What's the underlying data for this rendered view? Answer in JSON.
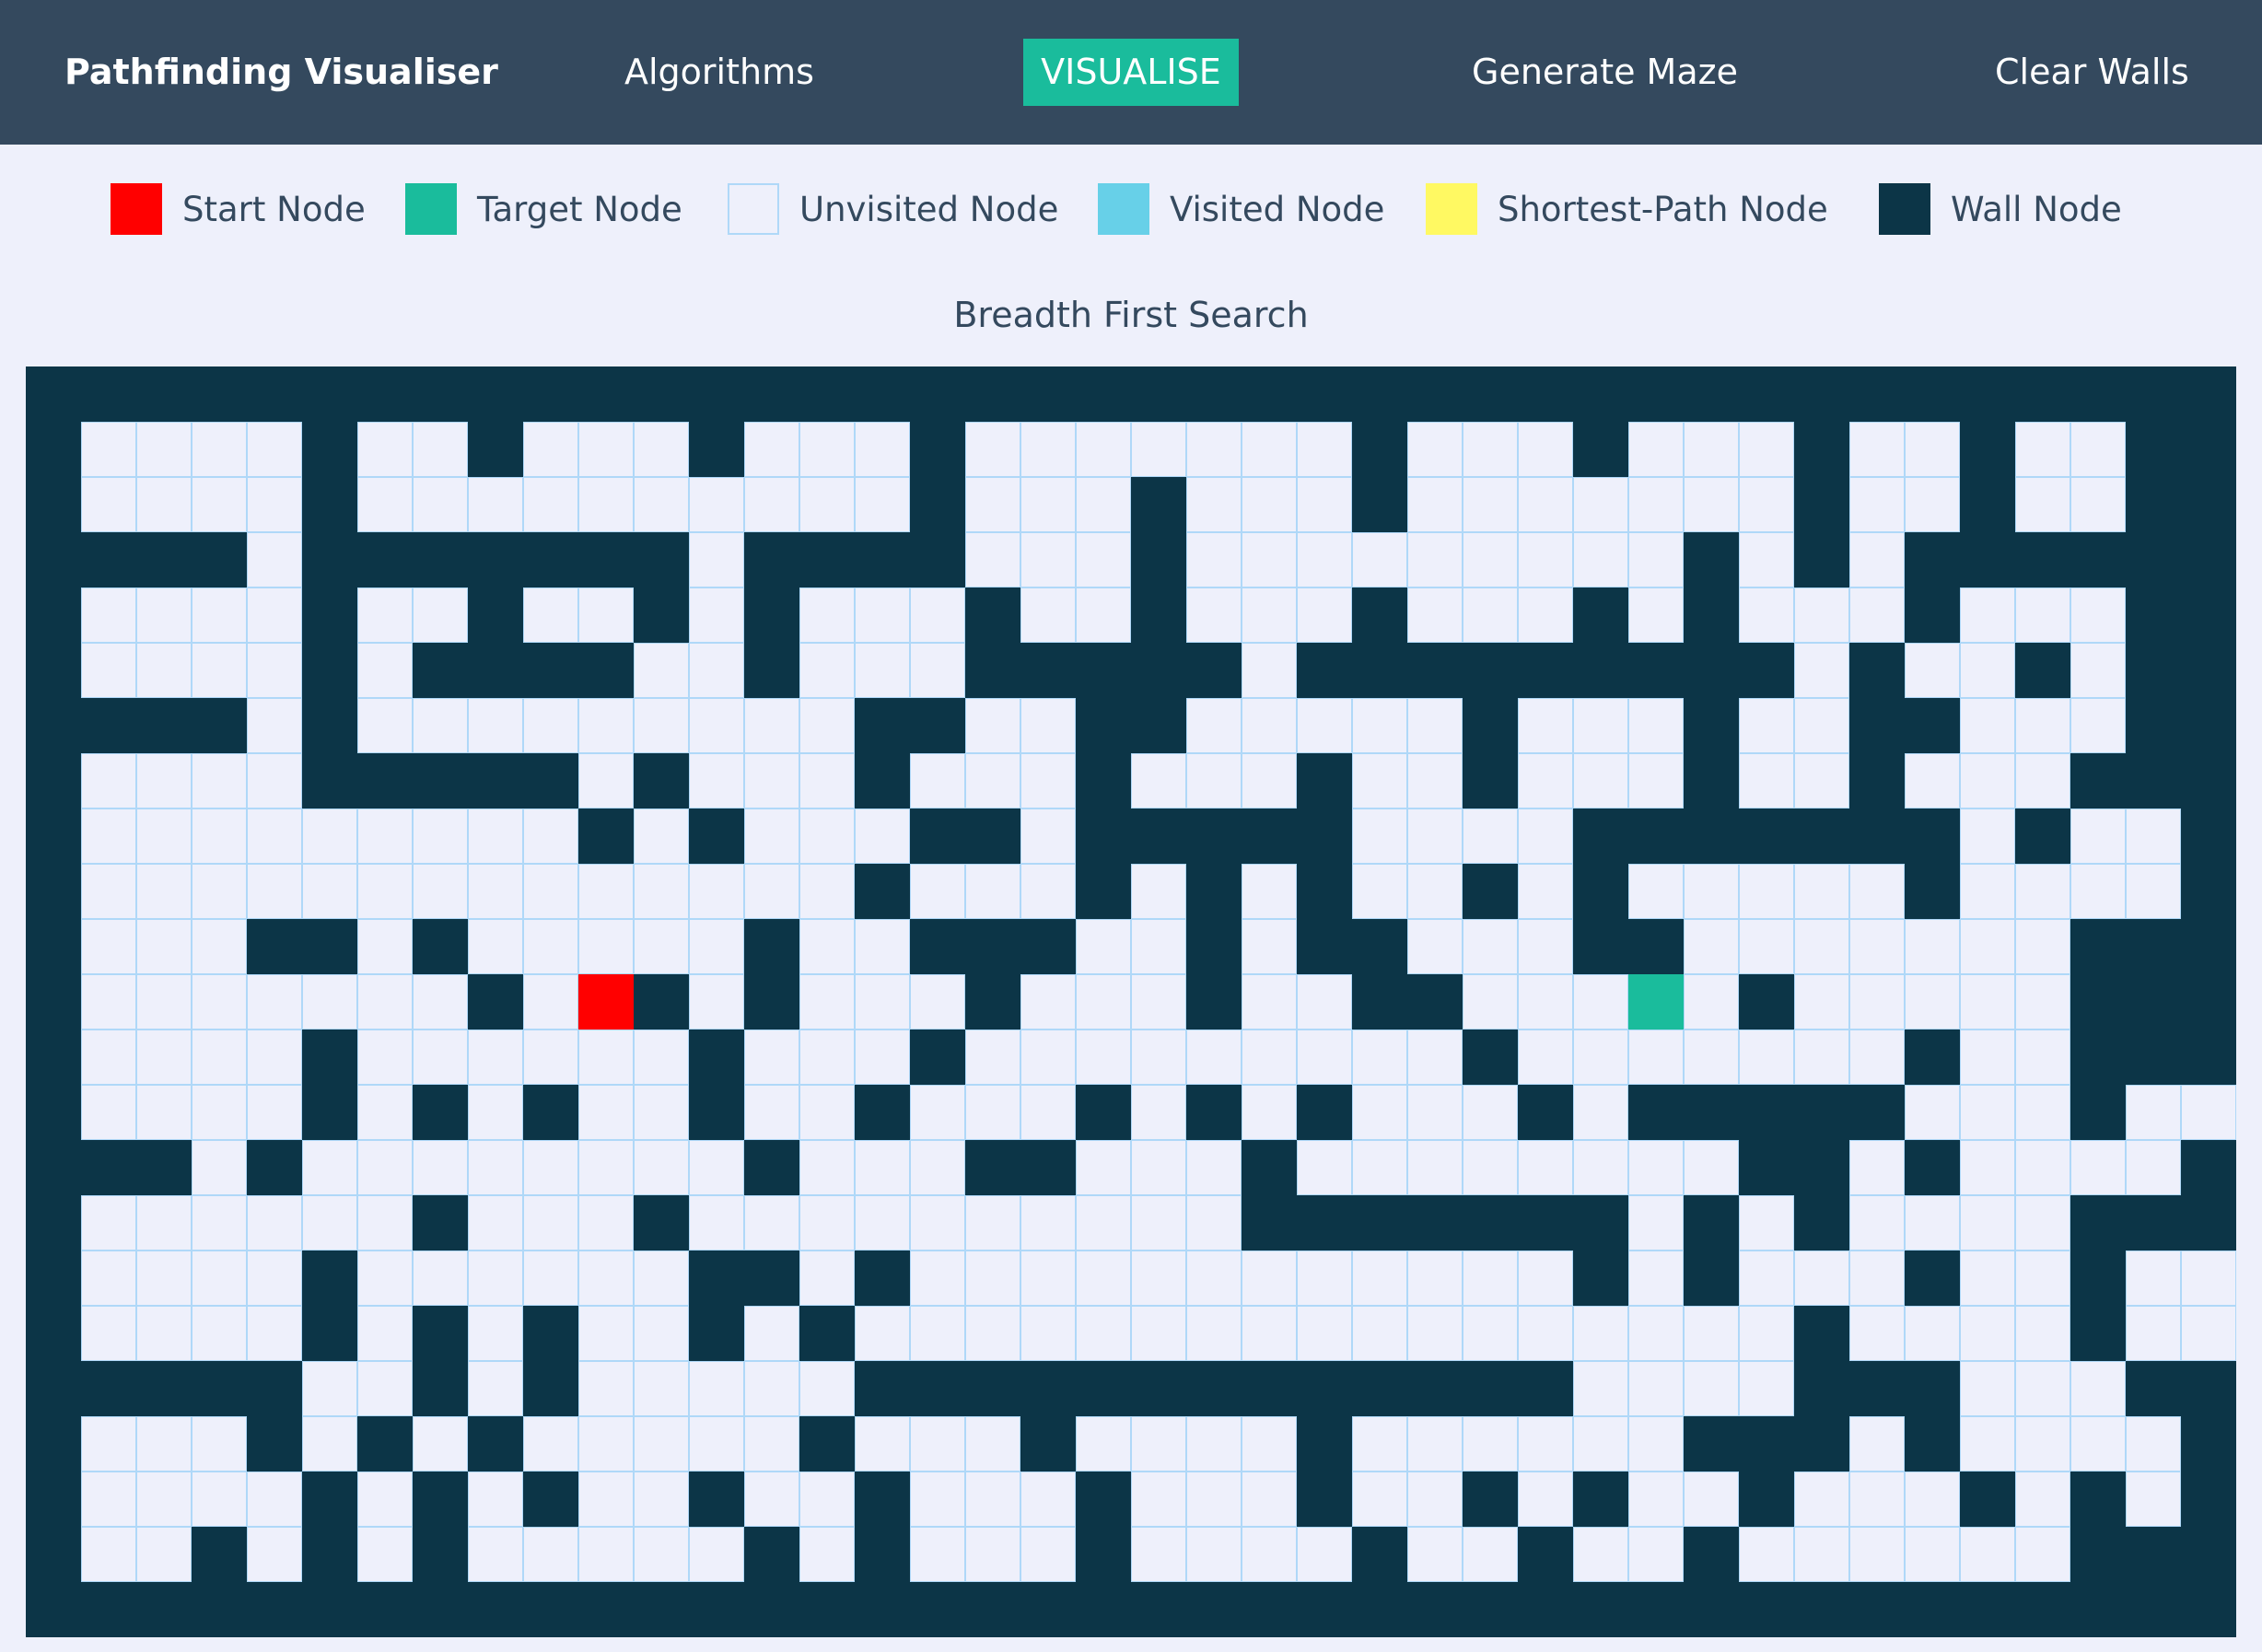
{
  "navbar": {
    "brand": "Pathfinding Visualiser",
    "algorithms_label": "Algorithms",
    "visualise_label": "VISUALISE",
    "generate_maze_label": "Generate Maze",
    "clear_walls_label": "Clear Walls"
  },
  "legend": [
    {
      "label": "Start Node",
      "color": "#ff0000"
    },
    {
      "label": "Target Node",
      "color": "#1abc9c"
    },
    {
      "label": "Unvisited Node",
      "color": "#eef0fb"
    },
    {
      "label": "Visited Node",
      "color": "#67d0e8"
    },
    {
      "label": "Shortest-Path Node",
      "color": "#fff962"
    },
    {
      "label": "Wall Node",
      "color": "#0c3547"
    }
  ],
  "algorithm_title": "Breadth First Search",
  "colors": {
    "navbar": "#34495e",
    "accent": "#1abc9c",
    "wall": "#0c3547",
    "unvisited": "#eef0fb",
    "cell_border": "#afd8f8",
    "background": "#eef0fb"
  },
  "grid": {
    "rows": 23,
    "cols": 40,
    "start": {
      "row": 11,
      "col": 10
    },
    "target": {
      "row": 11,
      "col": 29
    },
    "maze": [
      "########################################",
      "#....#..#...#...#.......#...#...#..#..#",
      "#....#..........#...#...#.......#..#..#",
      "####.#######.####...#.........#.#.####",
      "#....#..#..#.#...#..#...#...#.#...#...#",
      "#....#.####..#...#####.#########.#..#.#",
      "####.#.........##..##.....#...#..##...#",
      "#....#####.#...#...#...#..#...#..#...#",
      "#.........#.#...##.#####....#######.#..#",
      "#..............#...#.#.#..#.#.....#....#",
      "#...##.#.....#..###..#.##...##.......###",
      "#.......#..#.#...#...#..##.....#.....##",
      "#....#......#...#.........#.......#..#",
      "#....#.#.#..#..#...#.#.#...#.#####...#..#",
      "###.#........#...##...#........##.#....#",
      "#......#...#..........#######.#.#....##",
      "#....#......##.#............#.#...#..#..#",
      "#....#.#.#..#.#.................#....#..#",
      "#####..#.#.....#############....###...#",
      "#...#.#.#.....#...#....#......###.#....#",
      "#....#.#.#..#..#...#...#..#.#..#...#.#.#",
      "#..#.#.#.....#.#...#....#..#..#......#",
      "########################################"
    ]
  }
}
